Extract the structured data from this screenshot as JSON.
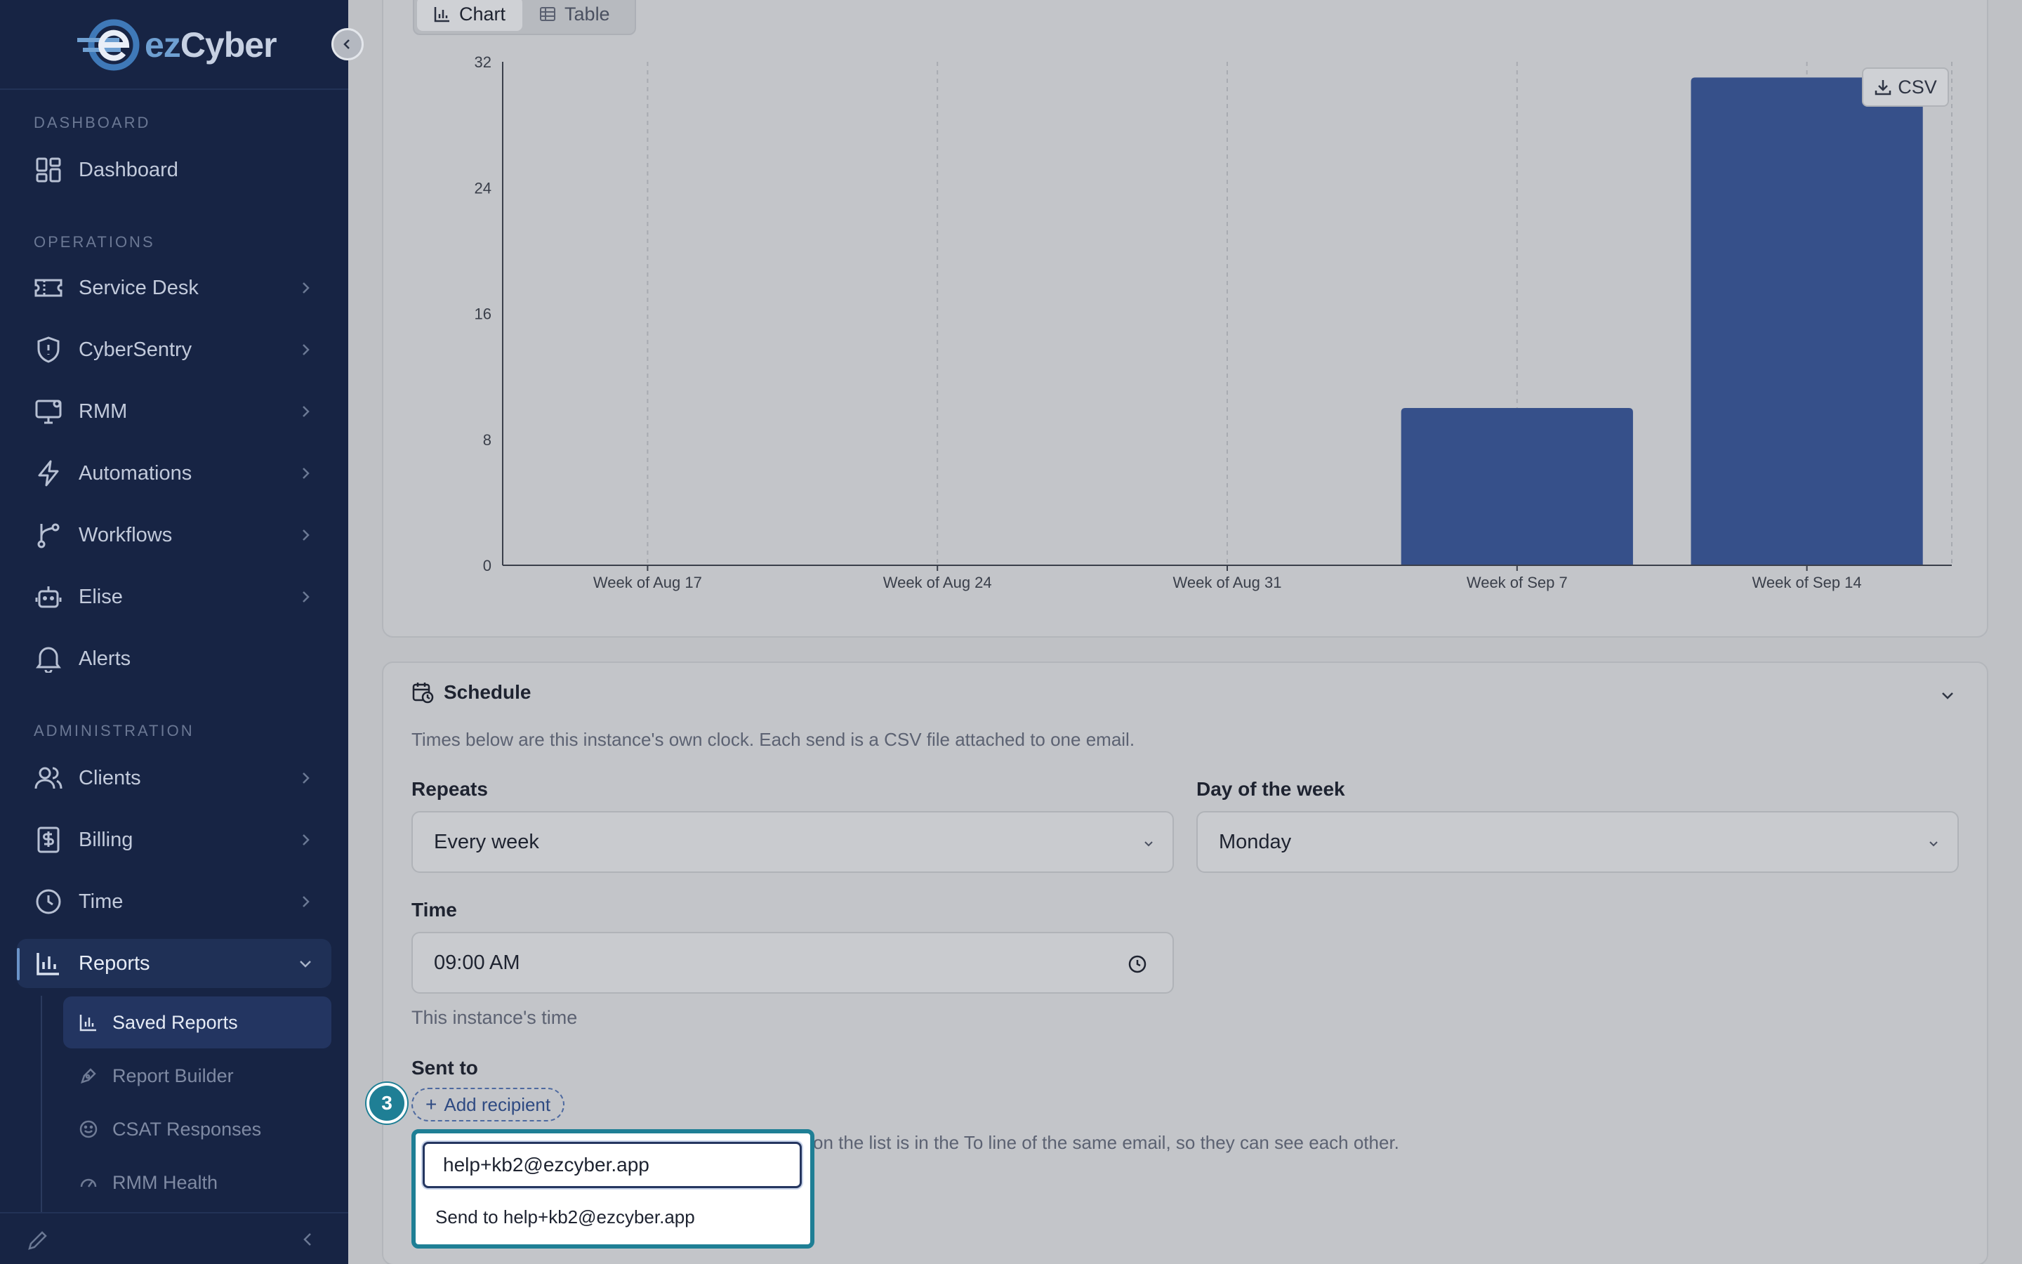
{
  "brand": {
    "name_part1": "ez",
    "name_part2": "Cyber"
  },
  "sidebar": {
    "sections": {
      "dashboard": "DASHBOARD",
      "operations": "OPERATIONS",
      "administration": "ADMINISTRATION"
    },
    "items": {
      "dashboard": "Dashboard",
      "service_desk": "Service Desk",
      "cybersentry": "CyberSentry",
      "rmm": "RMM",
      "automations": "Automations",
      "workflows": "Workflows",
      "elise": "Elise",
      "alerts": "Alerts",
      "clients": "Clients",
      "billing": "Billing",
      "time": "Time",
      "reports": "Reports"
    },
    "reports_sub": {
      "saved_reports": "Saved Reports",
      "report_builder": "Report Builder",
      "csat_responses": "CSAT Responses",
      "rmm_health": "RMM Health"
    }
  },
  "view_toggle": {
    "chart": "Chart",
    "table": "Table"
  },
  "csv_button": "CSV",
  "chart_data": {
    "type": "bar",
    "categories": [
      "Week of Aug 17",
      "Week of Aug 24",
      "Week of Aug 31",
      "Week of Sep 7",
      "Week of Sep 14"
    ],
    "values": [
      0,
      0,
      0,
      10,
      31
    ],
    "ylim": [
      0,
      32
    ],
    "yticks": [
      0,
      8,
      16,
      24,
      32
    ],
    "bar_color": "#36508a",
    "grid": "vertical dashed"
  },
  "schedule": {
    "title": "Schedule",
    "description": "Times below are this instance's own clock. Each send is a CSV file attached to one email.",
    "repeats_label": "Repeats",
    "repeats_value": "Every week",
    "day_label": "Day of the week",
    "day_value": "Monday",
    "time_label": "Time",
    "time_value": "09:00 AM",
    "time_hint": "This instance's time",
    "sent_to_label": "Sent to",
    "step_number": "3",
    "add_recipient": "Add recipient",
    "recipients_note": "on the list is in the To line of the same email, so they can see each other.",
    "popover_input": "help+kb2@ezcyber.app",
    "popover_option": "Send to help+kb2@ezcyber.app"
  }
}
